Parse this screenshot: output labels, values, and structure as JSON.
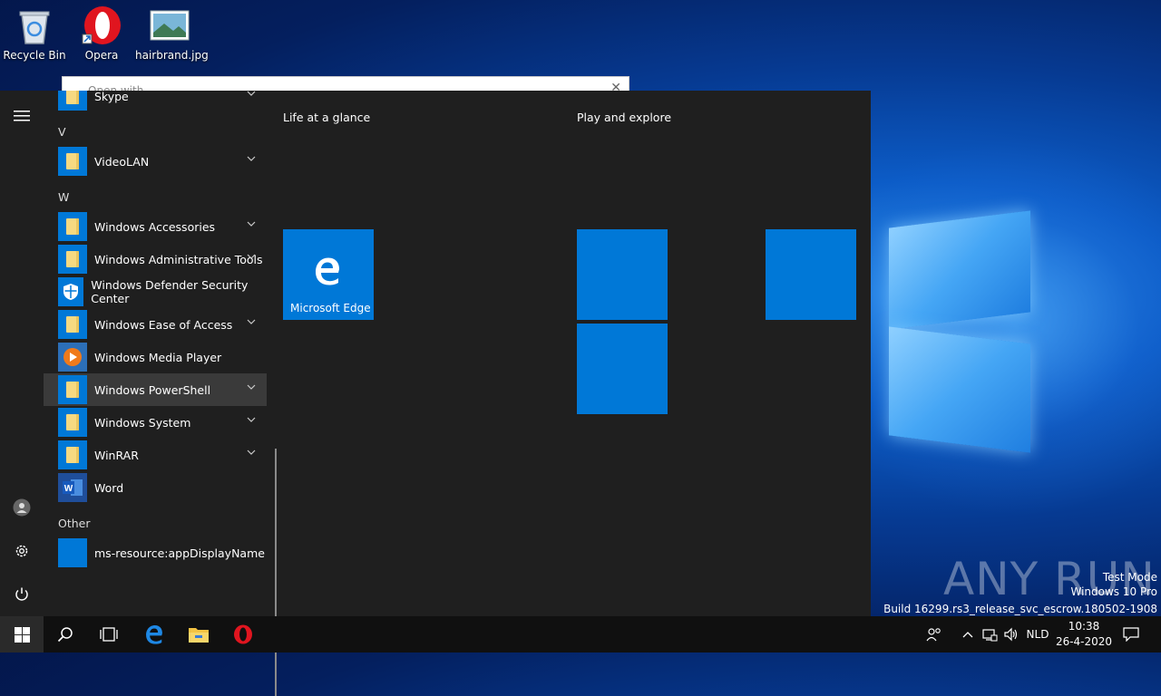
{
  "desktop": {
    "icons": [
      {
        "label": "Recycle Bin"
      },
      {
        "label": "Opera"
      },
      {
        "label": "hairbrand.jpg"
      }
    ]
  },
  "open_with_dialog": {
    "title": "Open with"
  },
  "start_menu": {
    "apps": [
      {
        "type": "app",
        "label": "Skype",
        "icon": "folder-icon",
        "expand": true
      },
      {
        "type": "letter",
        "label": "V"
      },
      {
        "type": "app",
        "label": "VideoLAN",
        "icon": "folder-icon",
        "expand": true
      },
      {
        "type": "letter",
        "label": "W"
      },
      {
        "type": "app",
        "label": "Windows Accessories",
        "icon": "folder-icon",
        "expand": true
      },
      {
        "type": "app",
        "label": "Windows Administrative Tools",
        "icon": "folder-icon",
        "expand": true
      },
      {
        "type": "app",
        "label": "Windows Defender Security Center",
        "icon": "shield-icon",
        "expand": false
      },
      {
        "type": "app",
        "label": "Windows Ease of Access",
        "icon": "folder-icon",
        "expand": true
      },
      {
        "type": "app",
        "label": "Windows Media Player",
        "icon": "media-player-icon",
        "expand": false
      },
      {
        "type": "app",
        "label": "Windows PowerShell",
        "icon": "folder-icon",
        "expand": true,
        "hover": true
      },
      {
        "type": "app",
        "label": "Windows System",
        "icon": "folder-icon",
        "expand": true
      },
      {
        "type": "app",
        "label": "WinRAR",
        "icon": "folder-icon",
        "expand": true
      },
      {
        "type": "app",
        "label": "Word",
        "icon": "word-icon",
        "expand": false
      },
      {
        "type": "letter",
        "label": "Other"
      },
      {
        "type": "app",
        "label": "ms-resource:appDisplayName",
        "icon": "blank-tile-icon",
        "expand": false
      }
    ],
    "groups": {
      "life": {
        "title": "Life at a glance",
        "tiles": [
          {
            "label": "Microsoft Edge",
            "icon": "edge-icon"
          }
        ]
      },
      "play": {
        "title": "Play and explore"
      }
    }
  },
  "watermark": {
    "brand": "ANY RUN",
    "line1": "Test Mode",
    "line2": "Windows 10 Pro",
    "line3": "Build 16299.rs3_release_svc_escrow.180502-1908"
  },
  "taskbar": {
    "language": "NLD",
    "time": "10:38",
    "date": "26-4-2020"
  },
  "colors": {
    "accent": "#0078d7",
    "menu_bg": "#1f1f1f",
    "taskbar_bg": "#101010"
  }
}
